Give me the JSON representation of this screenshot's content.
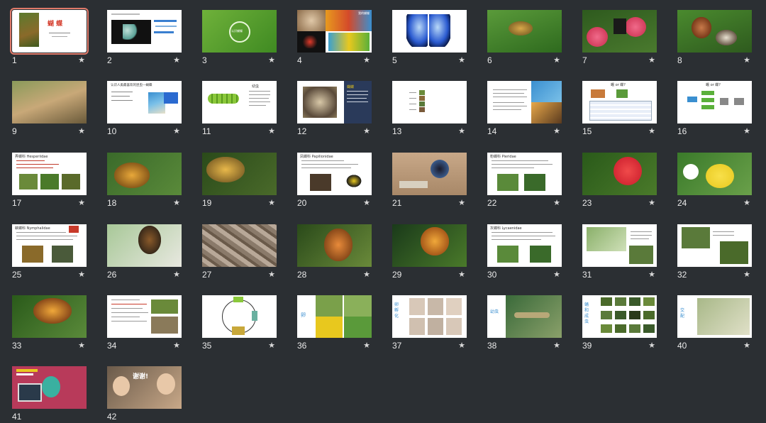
{
  "colors": {
    "background": "#2b2f33",
    "selection_outline": "#e07a6a",
    "slide_number_text": "#e9e9e9",
    "title_red": "#d43a2a",
    "title_blue": "#1e5aa0",
    "vertical_label_blue": "#3a8fd0"
  },
  "slides": [
    {
      "number": "1",
      "title": "蝴 蝶",
      "selected": true
    },
    {
      "number": "2"
    },
    {
      "number": "3",
      "text": "认识蝴蝶"
    },
    {
      "number": "4",
      "text": "我的蝴蝶"
    },
    {
      "number": "5"
    },
    {
      "number": "6"
    },
    {
      "number": "7"
    },
    {
      "number": "8"
    },
    {
      "number": "9"
    },
    {
      "number": "10",
      "title": "认识人类最喜欢的昆虫—蝴蝶"
    },
    {
      "number": "11",
      "title": "幼虫"
    },
    {
      "number": "12",
      "title": "蝴蝶"
    },
    {
      "number": "13"
    },
    {
      "number": "14"
    },
    {
      "number": "15",
      "title": "蛾 or 蝶?"
    },
    {
      "number": "16",
      "title": "蛾 or 蝶?"
    },
    {
      "number": "17",
      "title": "弄蝶科 Hesperiidae"
    },
    {
      "number": "18"
    },
    {
      "number": "19"
    },
    {
      "number": "20",
      "title": "凤蝶科 Papilionidae"
    },
    {
      "number": "21"
    },
    {
      "number": "22",
      "title": "粉蝶科 Pieridae"
    },
    {
      "number": "23"
    },
    {
      "number": "24"
    },
    {
      "number": "25",
      "title": "蛱蝶科 Nymphalidae"
    },
    {
      "number": "26"
    },
    {
      "number": "27"
    },
    {
      "number": "28"
    },
    {
      "number": "29"
    },
    {
      "number": "30",
      "title": "灰蝶科 Lycaenidae"
    },
    {
      "number": "31"
    },
    {
      "number": "32"
    },
    {
      "number": "33"
    },
    {
      "number": "34"
    },
    {
      "number": "35"
    },
    {
      "number": "36",
      "label": "卵"
    },
    {
      "number": "37",
      "label": "卵孵化"
    },
    {
      "number": "38",
      "label": "幼虫"
    },
    {
      "number": "39",
      "label": "蛹和成虫"
    },
    {
      "number": "40",
      "label": "交配"
    },
    {
      "number": "41"
    },
    {
      "number": "42",
      "caption": "谢谢!"
    }
  ],
  "icons": {
    "slide_marker": "star-icon"
  },
  "star_glyph": "★"
}
